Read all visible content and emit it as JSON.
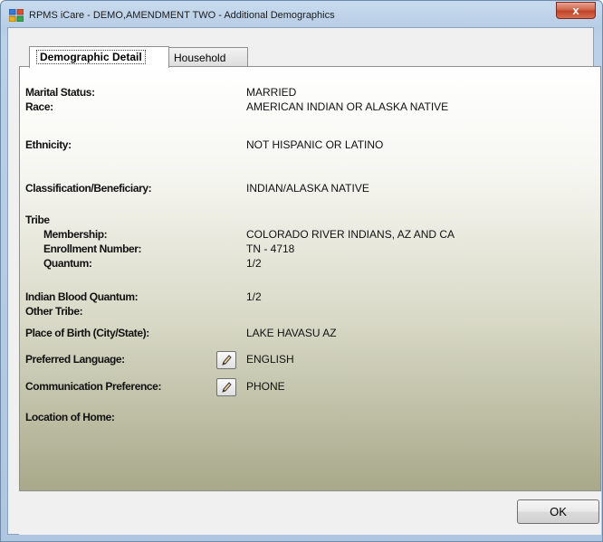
{
  "window": {
    "title": "RPMS iCare - DEMO,AMENDMENT TWO - Additional Demographics",
    "close_label": "x"
  },
  "tabs": [
    {
      "label": "Demographic Detail",
      "active": true
    },
    {
      "label": "Household",
      "active": false
    }
  ],
  "demographics": {
    "marital_status": {
      "label": "Marital Status:",
      "value": "MARRIED"
    },
    "race": {
      "label": "Race:",
      "value": "AMERICAN INDIAN OR ALASKA NATIVE"
    },
    "ethnicity": {
      "label": "Ethnicity:",
      "value": "NOT HISPANIC OR LATINO"
    },
    "classification": {
      "label": "Classification/Beneficiary:",
      "value": "INDIAN/ALASKA NATIVE"
    },
    "tribe": {
      "heading": "Tribe",
      "membership": {
        "label": "Membership:",
        "value": "COLORADO RIVER INDIANS, AZ AND CA"
      },
      "enrollment": {
        "label": "Enrollment Number:",
        "value": "TN - 4718"
      },
      "quantum": {
        "label": "Quantum:",
        "value": "1/2"
      }
    },
    "indian_blood_quantum": {
      "label": "Indian Blood Quantum:",
      "value": "1/2"
    },
    "other_tribe": {
      "label": "Other Tribe:",
      "value": ""
    },
    "place_of_birth": {
      "label": "Place of Birth (City/State):",
      "value": "LAKE HAVASU AZ"
    },
    "preferred_language": {
      "label": "Preferred Language:",
      "value": "ENGLISH"
    },
    "communication_preference": {
      "label": "Communication Preference:",
      "value": "PHONE"
    },
    "location_of_home": {
      "label": "Location of Home:",
      "value": ""
    }
  },
  "buttons": {
    "ok": "OK"
  },
  "colors": {
    "close_red": "#c04329",
    "title_bar": "#c9dbee"
  }
}
